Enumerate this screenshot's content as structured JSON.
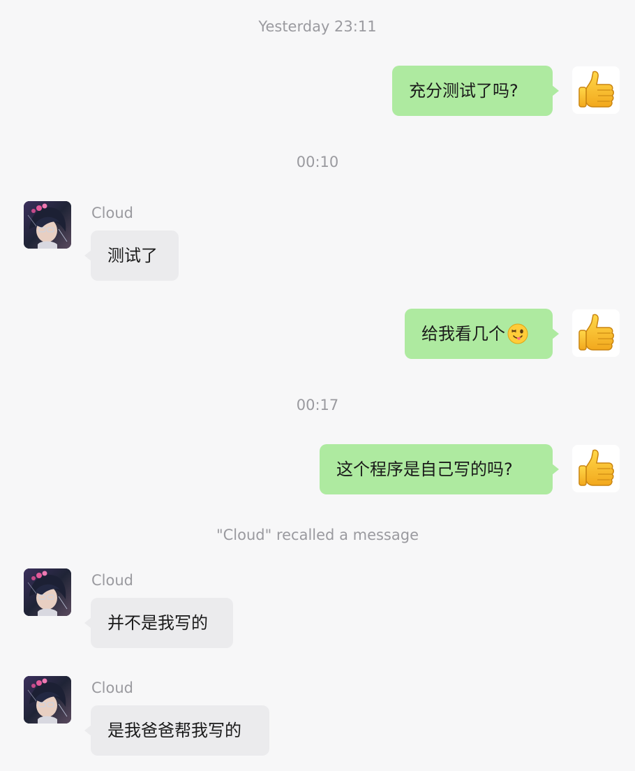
{
  "timestamps": [
    "Yesterday 23:11",
    "00:10",
    "00:17"
  ],
  "system_notice": "\"Cloud\" recalled a message",
  "contact": {
    "name": "Cloud",
    "avatar_icon": "anime-avatar-icon"
  },
  "me": {
    "avatar_icon": "thumbs-up-icon"
  },
  "messages": [
    {
      "from": "me",
      "text": "充分测试了吗?"
    },
    {
      "from": "Cloud",
      "sender": "Cloud",
      "text": "测试了"
    },
    {
      "from": "me",
      "text": "给我看几个",
      "emoji": "winking-tongue-face-icon"
    },
    {
      "from": "me",
      "text": "这个程序是自己写的吗?"
    },
    {
      "from": "Cloud",
      "sender": "Cloud",
      "text": "并不是我写的"
    },
    {
      "from": "Cloud",
      "sender": "Cloud",
      "text": "是我爸爸帮我写的"
    }
  ],
  "colors": {
    "background": "#f7f7f8",
    "outgoing_bubble": "#aeeaa0",
    "incoming_bubble": "#ebebed",
    "meta_text": "#9a9a9f"
  }
}
